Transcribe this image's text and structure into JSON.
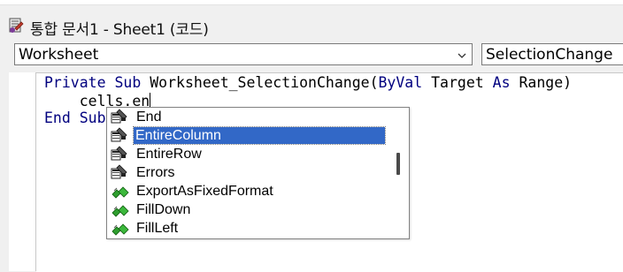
{
  "window": {
    "title": "통합 문서1 - Sheet1 (코드)"
  },
  "object_combo": {
    "value": "Worksheet"
  },
  "procedure_combo": {
    "value": "SelectionChange"
  },
  "code": {
    "line1_kw1": "Private Sub ",
    "line1_plain": "Worksheet_SelectionChange(",
    "line1_kw2": "ByVal ",
    "line1_plain2": "Target ",
    "line1_kw3": "As ",
    "line1_plain3": "Range)",
    "line2": "    cells.en",
    "line3": "End Sub"
  },
  "autocomplete": {
    "items": [
      {
        "label": "End",
        "icon": "property-icon"
      },
      {
        "label": "EntireColumn",
        "icon": "property-icon",
        "selected": true
      },
      {
        "label": "EntireRow",
        "icon": "property-icon"
      },
      {
        "label": "Errors",
        "icon": "property-icon"
      },
      {
        "label": "ExportAsFixedFormat",
        "icon": "method-icon"
      },
      {
        "label": "FillDown",
        "icon": "method-icon"
      },
      {
        "label": "FillLeft",
        "icon": "method-icon"
      }
    ]
  },
  "colors": {
    "keyword": "#00007f",
    "selection": "#3268c7",
    "method_green": "#2e9e2e"
  }
}
